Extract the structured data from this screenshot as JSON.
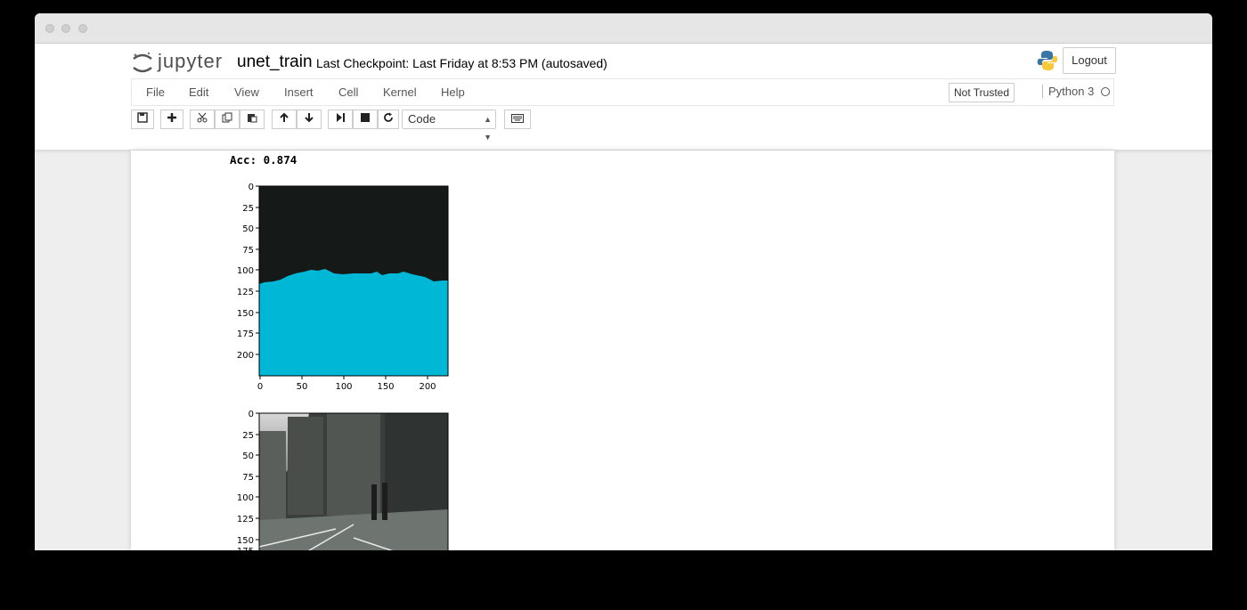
{
  "logo_text": "jupyter",
  "notebook_name": "unet_train",
  "checkpoint": "Last Checkpoint: Last Friday at 8:53 PM (autosaved)",
  "logout_label": "Logout",
  "menu": [
    "File",
    "Edit",
    "View",
    "Insert",
    "Cell",
    "Kernel",
    "Help"
  ],
  "trust_label": "Not Trusted",
  "kernel_name": "Python 3",
  "toolbar": {
    "buttons": [
      "save-icon",
      "add-cell-icon",
      "cut-icon",
      "copy-icon",
      "paste-icon",
      "move-up-icon",
      "move-down-icon",
      "run-icon",
      "stop-icon",
      "restart-icon"
    ],
    "cell_type": "Code",
    "keyboard_icon": "keyboard-icon"
  },
  "output": {
    "acc_text": "Acc: 0.874"
  },
  "plot1": {
    "yticks": [
      "0",
      "25",
      "50",
      "75",
      "100",
      "125",
      "150",
      "175",
      "200"
    ],
    "xticks": [
      "0",
      "50",
      "100",
      "150",
      "200"
    ],
    "colors": {
      "background": "#151a18",
      "foreground": "#00b8d6"
    }
  },
  "plot2": {
    "yticks": [
      "0",
      "25",
      "50",
      "75",
      "100",
      "125",
      "150",
      "175"
    ]
  }
}
